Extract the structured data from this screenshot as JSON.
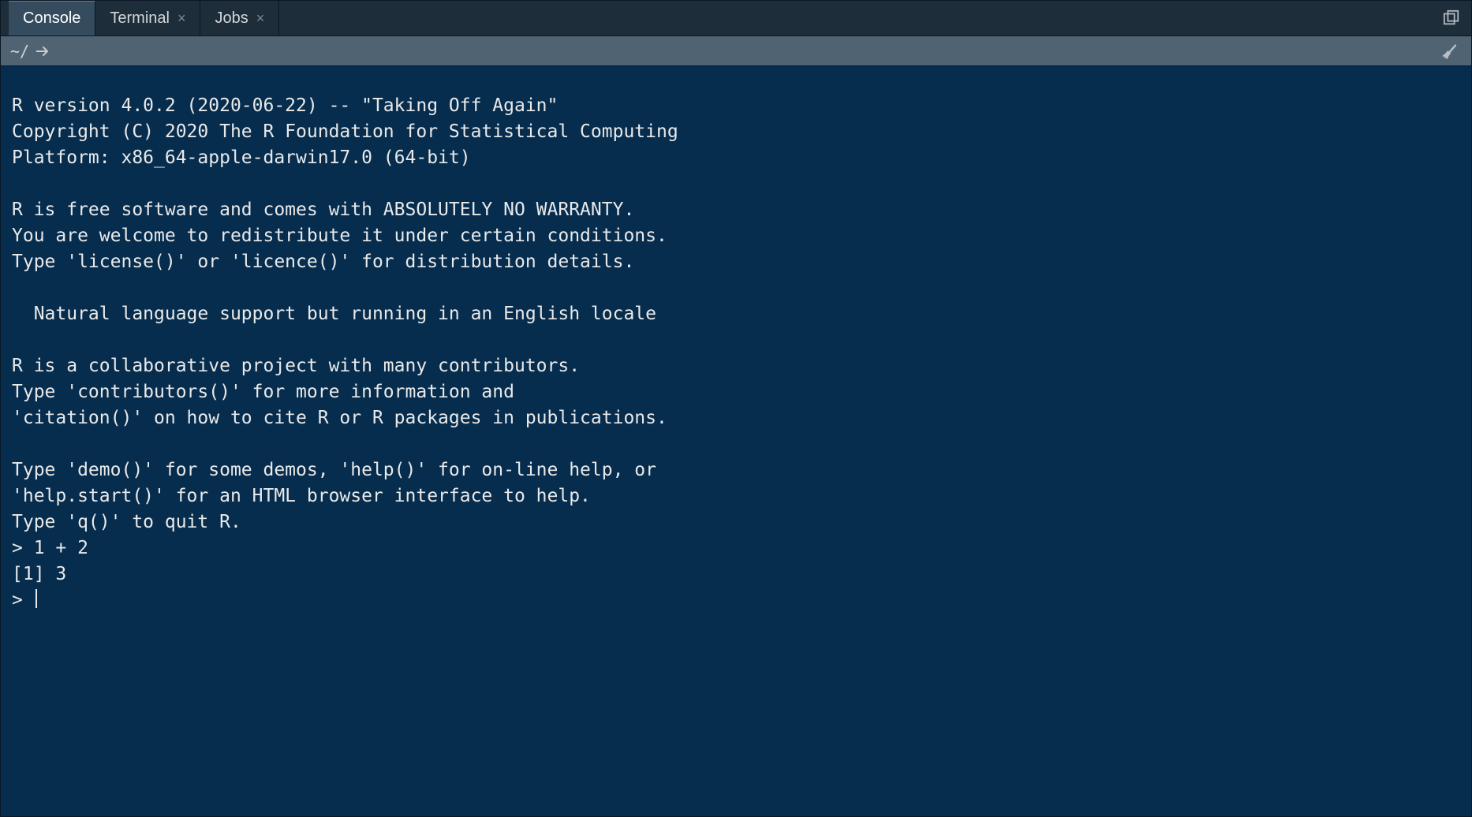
{
  "tabs": [
    {
      "label": "Console",
      "active": true,
      "closable": false
    },
    {
      "label": "Terminal",
      "active": false,
      "closable": true
    },
    {
      "label": "Jobs",
      "active": false,
      "closable": true
    }
  ],
  "toolbar": {
    "working_dir": "~/",
    "open_dir_icon": "open-dir-icon",
    "maximize_icon": "maximize-pane-icon",
    "clear_icon": "clear-console-icon"
  },
  "console": {
    "startup_text": "R version 4.0.2 (2020-06-22) -- \"Taking Off Again\"\nCopyright (C) 2020 The R Foundation for Statistical Computing\nPlatform: x86_64-apple-darwin17.0 (64-bit)\n\nR is free software and comes with ABSOLUTELY NO WARRANTY.\nYou are welcome to redistribute it under certain conditions.\nType 'license()' or 'licence()' for distribution details.\n\n  Natural language support but running in an English locale\n\nR is a collaborative project with many contributors.\nType 'contributors()' for more information and\n'citation()' on how to cite R or R packages in publications.\n\nType 'demo()' for some demos, 'help()' for on-line help, or\n'help.start()' for an HTML browser interface to help.\nType 'q()' to quit R.\n",
    "user_input_line": "> 1 + 2",
    "result_line": "[1] 3",
    "prompt": "> "
  }
}
